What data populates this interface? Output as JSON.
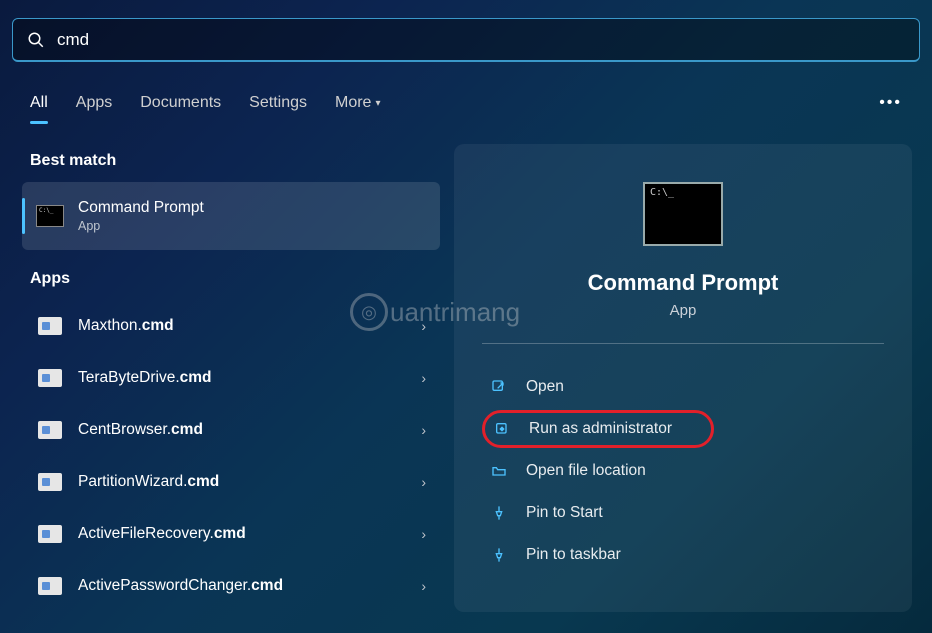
{
  "search": {
    "query": "cmd"
  },
  "tabs": {
    "items": [
      {
        "label": "All",
        "active": true
      },
      {
        "label": "Apps"
      },
      {
        "label": "Documents"
      },
      {
        "label": "Settings"
      },
      {
        "label": "More"
      }
    ]
  },
  "left": {
    "best_match_heading": "Best match",
    "best_match": {
      "title": "Command Prompt",
      "subtitle": "App"
    },
    "apps_heading": "Apps",
    "apps": [
      {
        "prefix": "Maxthon.",
        "bold": "cmd"
      },
      {
        "prefix": "TeraByteDrive.",
        "bold": "cmd"
      },
      {
        "prefix": "CentBrowser.",
        "bold": "cmd"
      },
      {
        "prefix": "PartitionWizard.",
        "bold": "cmd"
      },
      {
        "prefix": "ActiveFileRecovery.",
        "bold": "cmd"
      },
      {
        "prefix": "ActivePasswordChanger.",
        "bold": "cmd"
      }
    ]
  },
  "preview": {
    "title": "Command Prompt",
    "subtitle": "App",
    "actions": [
      {
        "icon": "open",
        "label": "Open"
      },
      {
        "icon": "shield",
        "label": "Run as administrator",
        "highlight": true
      },
      {
        "icon": "folder",
        "label": "Open file location"
      },
      {
        "icon": "pin",
        "label": "Pin to Start"
      },
      {
        "icon": "pin",
        "label": "Pin to taskbar"
      }
    ]
  },
  "watermark": "uantrimang"
}
